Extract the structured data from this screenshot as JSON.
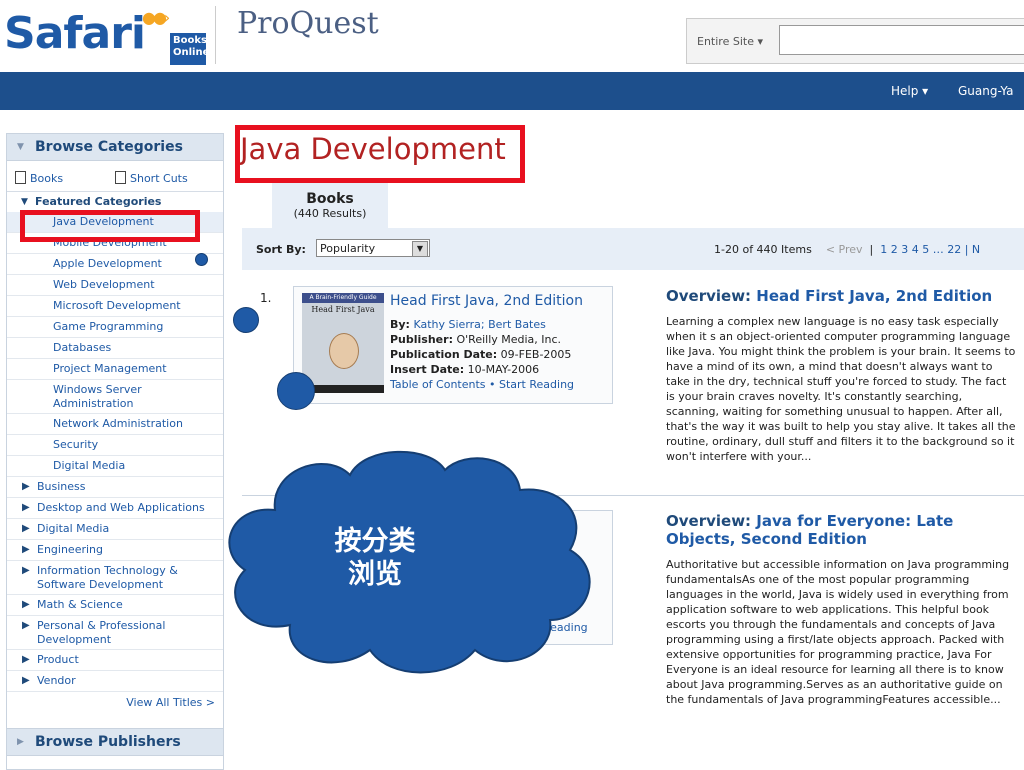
{
  "header": {
    "brand_name": "Safari",
    "brand_sub": "Books Online",
    "partner_logo": "ProQuest",
    "search_scope": "Entire Site",
    "search_value": ""
  },
  "navbar": {
    "help_label": "Help",
    "user_label": "Guang-Ya"
  },
  "sidebar": {
    "browse_categories": "Browse Categories",
    "tab_books": "Books",
    "tab_short_cuts": "Short Cuts",
    "featured_categories": "Featured Categories",
    "featured": [
      "Java Development",
      "Mobile Development",
      "Apple Development",
      "Web Development",
      "Microsoft Development",
      "Game Programming",
      "Databases",
      "Project Management",
      "Windows Server Administration",
      "Network Administration",
      "Security",
      "Digital Media"
    ],
    "categories": [
      "Business",
      "Desktop and Web Applications",
      "Digital Media",
      "Engineering",
      "Information Technology & Software Development",
      "Math & Science",
      "Personal & Professional Development",
      "Product",
      "Vendor"
    ],
    "view_all": "View All Titles >",
    "browse_publishers": "Browse Publishers"
  },
  "main": {
    "page_title": "Java Development",
    "books_tab": "Books",
    "results_count": "(440 Results)",
    "sort_label": "Sort By:",
    "sort_value": "Popularity",
    "items_range": "1-20 of 440 Items",
    "prev": "< Prev",
    "pages": "1  2  3  4  5 … 22  |  N"
  },
  "results": [
    {
      "number": "1.",
      "cover_band": "A Brain-Friendly Guide",
      "cover_title": "Head First Java",
      "title": "Head First Java, 2nd Edition",
      "by_label": "By:",
      "authors": "Kathy Sierra; Bert Bates",
      "publisher_label": "Publisher:",
      "publisher": "O'Reilly Media, Inc.",
      "pubdate_label": "Publication Date:",
      "pubdate": "09-FEB-2005",
      "insert_label": "Insert Date:",
      "insert_date": "10-MAY-2006",
      "links": "Table of Contents • Start Reading",
      "overview_label": "Overview:",
      "overview_title": "Head First Java, 2nd Edition",
      "overview_text": "Learning a complex new language is no easy task especially when it s an object-oriented computer programming language like Java. You might think the problem is your brain. It seems to have a mind of its own, a mind that doesn't always want to take in the dry, technical stuff you're forced to study. The fact is your brain craves novelty. It's constantly searching, scanning, waiting for something unusual to happen. After all, that's the way it was built to help you stay alive. It takes all the routine, ordinary, dull stuff and filters it to the background so it won't interfere with your..."
    },
    {
      "links_partial": "Reading",
      "overview_label": "Overview:",
      "overview_title": "Java for Everyone: Late Objects, Second Edition",
      "overview_text": "Authoritative but accessible information on Java programming fundamentalsAs one of the most popular programming languages in the world, Java is widely used in everything from application software to web applications. This helpful book escorts you through the fundamentals and concepts of Java programming using a first/late objects approach. Packed with extensive opportunities for programming practice, Java For Everyone is an ideal resource for learning all there is to know about Java programming.Serves as an authoritative guide on the fundamentals of Java programmingFeatures accessible..."
    }
  ],
  "annotation": {
    "callout_text": "按分类\n浏览",
    "callout_line1": "按分类",
    "callout_line2": "浏览",
    "highlight_color": "#e8101f",
    "cloud_color": "#1f5aa6"
  }
}
